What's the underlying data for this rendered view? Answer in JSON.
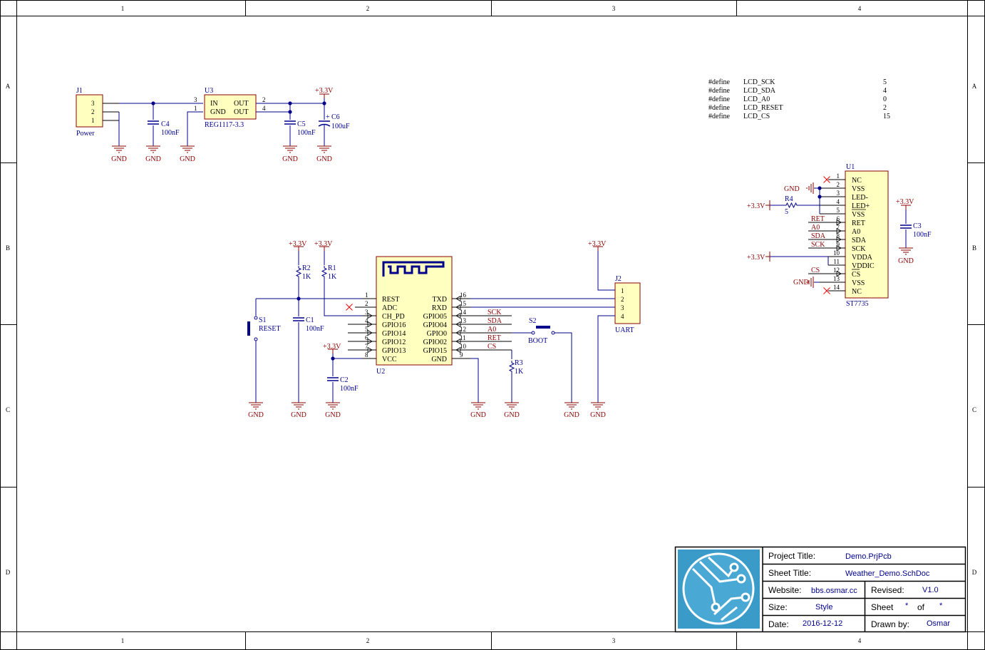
{
  "frame": {
    "columns": [
      "1",
      "2",
      "3",
      "4"
    ],
    "rows": [
      "A",
      "B",
      "C",
      "D"
    ]
  },
  "colors": {
    "wire": "#00008b",
    "label": "#8b0000",
    "body_fill": "#ffffc0",
    "body_stroke": "#8b0000",
    "border": "#000000",
    "no_connect": "#ff0000",
    "logo_bg": "#3b9bc8"
  },
  "defines": [
    {
      "kw": "#define",
      "name": "LCD_SCK",
      "val": "5"
    },
    {
      "kw": "#define",
      "name": "LCD_SDA",
      "val": "4"
    },
    {
      "kw": "#define",
      "name": "LCD_A0",
      "val": "0"
    },
    {
      "kw": "#define",
      "name": "LCD_RESET",
      "val": "2"
    },
    {
      "kw": "#define",
      "name": "LCD_CS",
      "val": "15"
    }
  ],
  "power": {
    "j1_ref": "J1",
    "j1_name": "Power",
    "j1_pins": [
      "3",
      "2",
      "1"
    ],
    "u3_ref": "U3",
    "u3_part": "REG1117-3.3",
    "u3_in": "IN",
    "u3_gnd": "GND",
    "u3_out1": "OUT",
    "u3_out2": "OUT",
    "u3_pin_in": "3",
    "u3_pin_gnd": "1",
    "u3_pin_out1": "2",
    "u3_pin_out2": "4",
    "c4_ref": "C4",
    "c4_val": "100nF",
    "c5_ref": "C5",
    "c5_val": "100nF",
    "c6_ref": "C6",
    "c6_val": "100uF",
    "c6_plus": "+",
    "vcc": "+3.3V"
  },
  "gnd": "GND",
  "esp": {
    "ref": "U2",
    "left_pins": [
      {
        "name": "REST",
        "num": "1"
      },
      {
        "name": "ADC",
        "num": "2"
      },
      {
        "name": "CH_PD",
        "num": "3"
      },
      {
        "name": "GPIO16",
        "num": "4"
      },
      {
        "name": "GPIO14",
        "num": "5"
      },
      {
        "name": "GPIO12",
        "num": "6"
      },
      {
        "name": "GPIO13",
        "num": "7"
      },
      {
        "name": "VCC",
        "num": "8"
      }
    ],
    "right_pins": [
      {
        "name": "TXD",
        "num": "16",
        "net": ""
      },
      {
        "name": "RXD",
        "num": "15",
        "net": ""
      },
      {
        "name": "GPIO05",
        "num": "14",
        "net": "SCK"
      },
      {
        "name": "GPIO04",
        "num": "13",
        "net": "SDA"
      },
      {
        "name": "GPIO0",
        "num": "12",
        "net": "A0"
      },
      {
        "name": "GPIO02",
        "num": "11",
        "net": "RET"
      },
      {
        "name": "GPIO15",
        "num": "10",
        "net": "CS"
      },
      {
        "name": "GND",
        "num": "9",
        "net": ""
      }
    ]
  },
  "parts": {
    "r1_ref": "R1",
    "r1_val": "1K",
    "r2_ref": "R2",
    "r2_val": "1K",
    "r3_ref": "R3",
    "r3_val": "1K",
    "r4_ref": "R4",
    "r4_val": "5",
    "c1_ref": "C1",
    "c1_val": "100nF",
    "c2_ref": "C2",
    "c2_val": "100nF",
    "c3_ref": "C3",
    "c3_val": "100nF",
    "s1_ref": "S1",
    "s1_name": "RESET",
    "s2_ref": "S2",
    "s2_name": "BOOT",
    "j2_ref": "J2",
    "j2_name": "UART",
    "j2_pins": [
      "1",
      "2",
      "3",
      "4"
    ]
  },
  "lcd": {
    "ref": "U1",
    "part": "ST7735",
    "pins": [
      {
        "num": "1",
        "name": "NC",
        "net": ""
      },
      {
        "num": "2",
        "name": "VSS",
        "net": ""
      },
      {
        "num": "3",
        "name": "LED-",
        "net": ""
      },
      {
        "num": "4",
        "name": "LED+",
        "net": ""
      },
      {
        "num": "5",
        "name": "VSS",
        "net": ""
      },
      {
        "num": "6",
        "name": "RET",
        "net": "RET"
      },
      {
        "num": "7",
        "name": "A0",
        "net": "A0"
      },
      {
        "num": "8",
        "name": "SDA",
        "net": "SDA"
      },
      {
        "num": "9",
        "name": "SCK",
        "net": "SCK"
      },
      {
        "num": "10",
        "name": "VDDA",
        "net": ""
      },
      {
        "num": "11",
        "name": "VDDIC",
        "net": ""
      },
      {
        "num": "12",
        "name": "CS",
        "net": "CS"
      },
      {
        "num": "13",
        "name": "VSS",
        "net": ""
      },
      {
        "num": "14",
        "name": "NC",
        "net": ""
      }
    ]
  },
  "title_block": {
    "project_label": "Project Title:",
    "project_value": "Demo.PrjPcb",
    "sheet_label": "Sheet Title:",
    "sheet_value": "Weather_Demo.SchDoc",
    "website_label": "Website:",
    "website_value": "bbs.osmar.cc",
    "revised_label": "Revised:",
    "revised_value": "V1.0",
    "size_label": "Size:",
    "size_value": "Style",
    "sheet_no_label": "Sheet",
    "sheet_no_value": "*",
    "of_label": "of",
    "of_value": "*",
    "date_label": "Date:",
    "date_value": "2016-12-12",
    "drawn_label": "Drawn by:",
    "drawn_value": "Osmar"
  }
}
